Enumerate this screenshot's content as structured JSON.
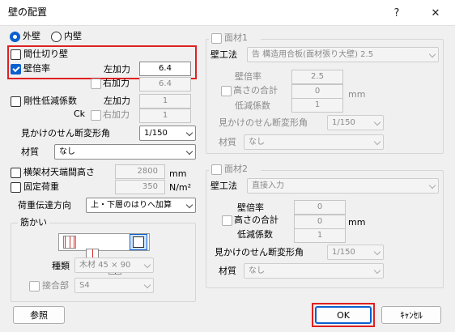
{
  "window": {
    "title": "壁の配置"
  },
  "wall_side": {
    "outer": "外壁",
    "inner": "内壁",
    "selected": "outer"
  },
  "partition": {
    "label": "間仕切り壁",
    "checked": false
  },
  "multiplier": {
    "label": "壁倍率",
    "checked": true,
    "left_label": "左加力",
    "left_value": "6.4",
    "right_label": "右加力",
    "right_value": "6.4",
    "right_checked": false
  },
  "rigidity": {
    "label": "剛性低減係数",
    "checked": false,
    "left_label": "左加力",
    "left_value": "1",
    "ck_label": "Ck",
    "right_label": "右加力",
    "right_value": "1",
    "right_checked": false
  },
  "shear_angle": {
    "label": "見かけのせん断変形角",
    "value": "1/150"
  },
  "material": {
    "label": "材質",
    "value": "なし"
  },
  "beam_height": {
    "label": "横架材天端間高さ",
    "checked": false,
    "value": "2800",
    "unit": "mm"
  },
  "fixed_load": {
    "label": "固定荷重",
    "checked": false,
    "value": "350",
    "unit": "N/m²"
  },
  "load_transfer": {
    "label": "荷重伝達方向",
    "value": "上・下層のはりへ加算"
  },
  "brace": {
    "group_label": "筋かい",
    "type_label": "種類",
    "type_value": "木材 45 × 90",
    "joint_label": "接合部",
    "joint_checked": false,
    "joint_value": "S4"
  },
  "panel1": {
    "title": "面材1",
    "checked": false,
    "method_label": "壁工法",
    "method_value": "告 構造用合板(面材張り大壁) 2.5",
    "multiplier_label": "壁倍率",
    "multiplier_value": "2.5",
    "height_total_label": "高さの合計",
    "height_total_value": "0",
    "unit": "mm",
    "reduction_label": "低減係数",
    "reduction_value": "1",
    "shear_label": "見かけのせん断変形角",
    "shear_value": "1/150",
    "material_label": "材質",
    "material_value": "なし"
  },
  "panel2": {
    "title": "面材2",
    "checked": false,
    "method_label": "壁工法",
    "method_value": "直接入力",
    "multiplier_label": "壁倍率",
    "multiplier_value": "0",
    "height_total_label": "高さの合計",
    "height_total_value": "0",
    "unit": "mm",
    "reduction_label": "低減係数",
    "reduction_value": "1",
    "shear_label": "見かけのせん断変形角",
    "shear_value": "1/150",
    "material_label": "材質",
    "material_value": "なし"
  },
  "buttons": {
    "browse": "参照",
    "ok": "OK",
    "cancel": "ｷｬﾝｾﾙ"
  },
  "accent": "#0b5fcf",
  "highlight": "#e02020"
}
